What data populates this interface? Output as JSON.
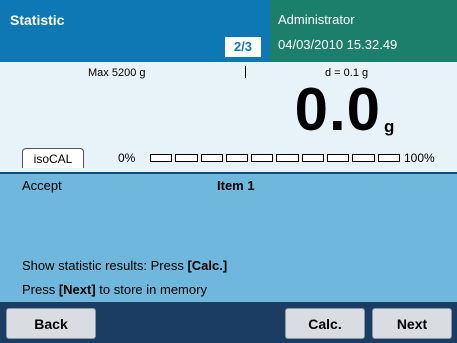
{
  "header": {
    "title": "Statistic",
    "page_indicator": "2/3",
    "user": "Administrator",
    "datetime": "04/03/2010 15.32.49"
  },
  "weighing": {
    "max_label": "Max 5200 g",
    "resolution": "d = 0.1 g",
    "value": "0.0",
    "unit": "g",
    "isocal_label": "isoCAL",
    "bar_start": "0%",
    "bar_end": "100%",
    "bar_fill_percent": 0
  },
  "info": {
    "accept_label": "Accept",
    "item_label": "Item 1",
    "msg1_prefix": "Show statistic results: Press ",
    "msg1_key": "[Calc.]",
    "msg2_prefix": "Press ",
    "msg2_key": "[Next]",
    "msg2_suffix": " to store in memory"
  },
  "buttons": {
    "back": "Back",
    "calc": "Calc.",
    "next": "Next"
  },
  "colors": {
    "header_bg": "#0d78b4",
    "user_panel_bg": "#1b7f6c",
    "weigh_bg": "#e8f2f9",
    "info_bg": "#6fb7dc",
    "button_bar_bg": "#1b3c63"
  }
}
